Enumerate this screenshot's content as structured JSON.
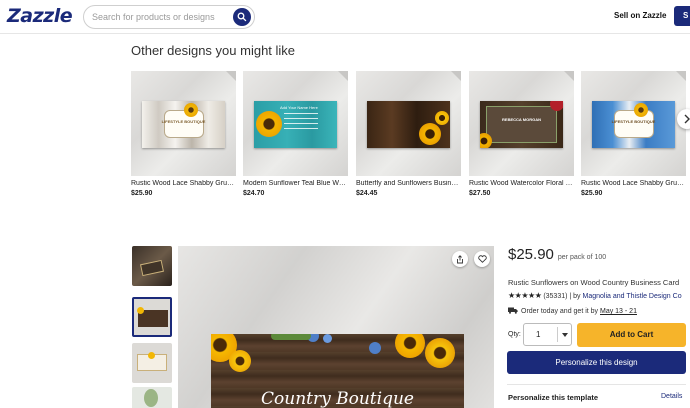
{
  "header": {
    "logo": "Zazzle",
    "search_placeholder": "Search for products or designs",
    "sell_label": "Sell on Zazzle",
    "cta_label": "S"
  },
  "related": {
    "title": "Other designs you might like",
    "items": [
      {
        "name": "Rustic Wood Lace Shabby Grunge Sunflower Business Card",
        "price": "$25.90",
        "card_text": "LIFESTYLE BOUTIQUE"
      },
      {
        "name": "Modern Sunflower Teal Blue Wood Business Card",
        "price": "$24.70",
        "card_text": "Add Your Name Here"
      },
      {
        "name": "Butterfly and Sunflowers Business Card",
        "price": "$24.45",
        "card_text": ""
      },
      {
        "name": "Rustic Wood Watercolor Floral Red Sunflower Business Card",
        "price": "$27.50",
        "card_text": "REBECCA MORGAN"
      },
      {
        "name": "Rustic Wood Lace Shabby Grunge Blue Business Card",
        "price": "$25.90",
        "card_text": "LIFESTYLE BOUTIQUE"
      }
    ]
  },
  "product": {
    "price": "$25.90",
    "per_pack": "per pack of 100",
    "title": "Rustic Sunflowers on Wood Country Business Card",
    "stars": "★★★★★",
    "rating_count": "(35331)",
    "by_text": " | by ",
    "designer": "Magnolia and Thistle Design Co",
    "order_text": "Order today and get it by ",
    "order_dates": "May 13 - 21",
    "qty_label": "Qty:",
    "qty_value": "1",
    "add_to_cart": "Add to Cart",
    "personalize_btn": "Personalize this design",
    "personalize_template": "Personalize this template",
    "details_link": "Details",
    "card_title": "Country Boutique"
  },
  "colors": {
    "brand_navy": "#1b2a7a",
    "cart_yellow": "#f6b42a"
  }
}
